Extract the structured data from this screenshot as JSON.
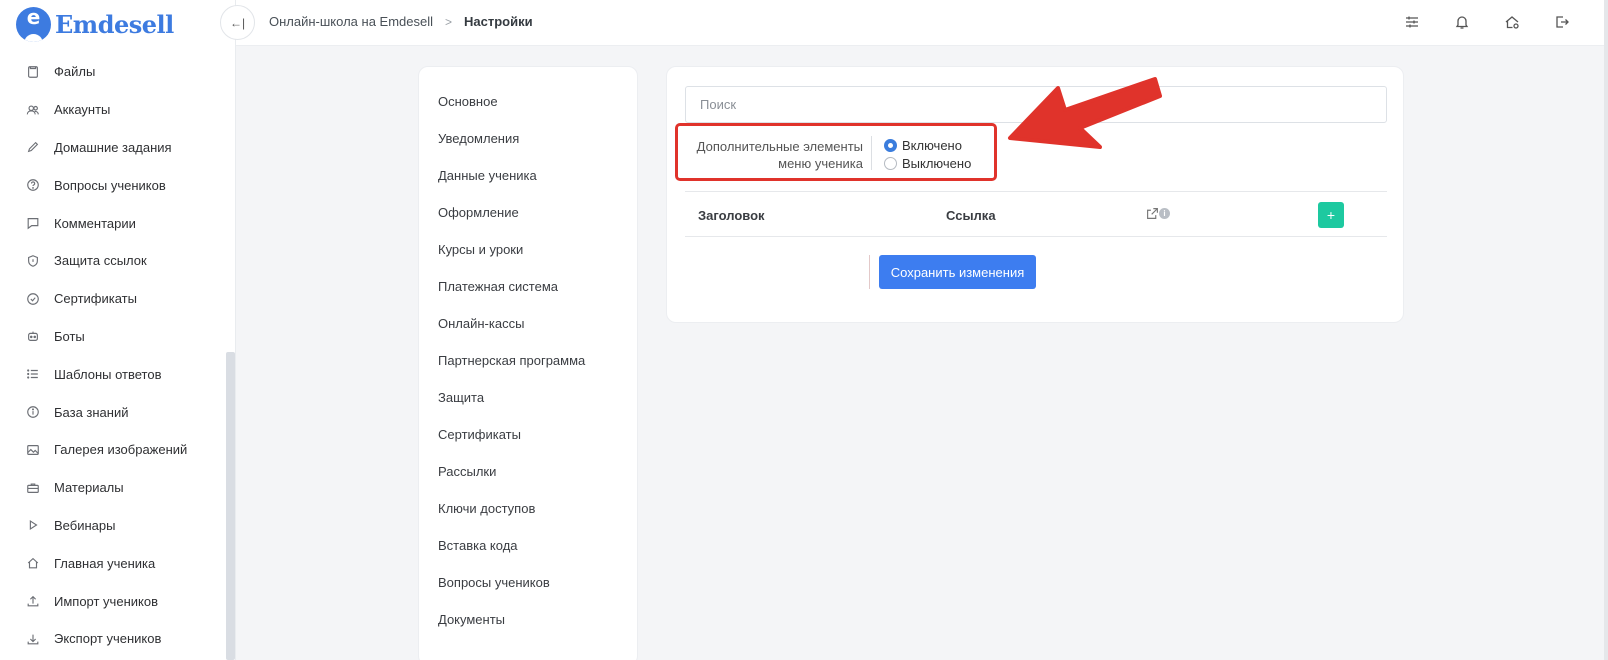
{
  "brand": {
    "name": "Emdesell",
    "badge_letter": "e",
    "color": "#3d7be0"
  },
  "sidebar": {
    "items": [
      {
        "label": "Файлы",
        "icon": "file-icon"
      },
      {
        "label": "Аккаунты",
        "icon": "users-icon"
      },
      {
        "label": "Домашние задания",
        "icon": "pencil-icon"
      },
      {
        "label": "Вопросы учеников",
        "icon": "question-icon"
      },
      {
        "label": "Комментарии",
        "icon": "comment-icon"
      },
      {
        "label": "Защита ссылок",
        "icon": "shield-icon"
      },
      {
        "label": "Сертификаты",
        "icon": "check-circle-icon"
      },
      {
        "label": "Боты",
        "icon": "bot-icon"
      },
      {
        "label": "Шаблоны ответов",
        "icon": "list-icon"
      },
      {
        "label": "База знаний",
        "icon": "info-icon"
      },
      {
        "label": "Галерея изображений",
        "icon": "image-icon"
      },
      {
        "label": "Материалы",
        "icon": "briefcase-icon"
      },
      {
        "label": "Вебинары",
        "icon": "play-icon"
      },
      {
        "label": "Главная ученика",
        "icon": "home-icon"
      },
      {
        "label": "Импорт учеников",
        "icon": "upload-icon"
      },
      {
        "label": "Экспорт учеников",
        "icon": "download-icon"
      }
    ]
  },
  "header": {
    "collapse_glyph": "←|",
    "breadcrumb": {
      "parent": "Онлайн-школа на Emdesell",
      "separator": ">",
      "current": "Настройки"
    },
    "icons": [
      "sliders-icon",
      "bell-icon",
      "home-settings-icon",
      "logout-icon"
    ]
  },
  "settings_menu": {
    "items": [
      "Основное",
      "Уведомления",
      "Данные ученика",
      "Оформление",
      "Курсы и уроки",
      "Платежная система",
      "Онлайн-кассы",
      "Партнерская программа",
      "Защита",
      "Сертификаты",
      "Рассылки",
      "Ключи доступов",
      "Вставка кода",
      "Вопросы учеников",
      "Документы"
    ]
  },
  "panel": {
    "search_placeholder": "Поиск",
    "option": {
      "label_line1": "Дополнительные элементы",
      "label_line2": "меню ученика",
      "choices": [
        {
          "label": "Включено",
          "selected": true
        },
        {
          "label": "Выключено",
          "selected": false
        }
      ]
    },
    "table": {
      "col_title": "Заголовок",
      "col_link": "Ссылка",
      "info_glyph": "i",
      "add_glyph": "+"
    },
    "save_label": "Сохранить изменения"
  },
  "colors": {
    "accent": "#3d7df0",
    "add": "#1dc9a0",
    "annotation": "#e0332b"
  }
}
